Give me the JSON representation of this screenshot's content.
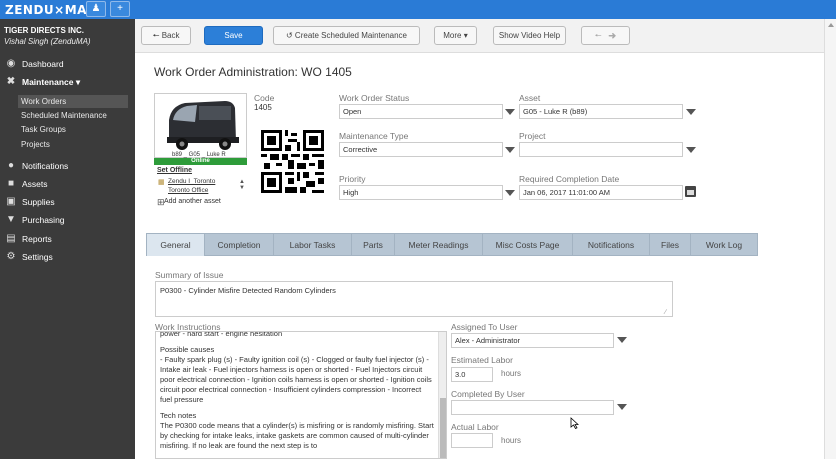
{
  "app": {
    "logo": "ZENDU×MA"
  },
  "topbar": {
    "user_icon": "user-icon",
    "add_icon": "plus-icon"
  },
  "sidebar": {
    "company": "TIGER DIRECTS INC.",
    "user": "Vishal Singh (ZenduMA)",
    "dashboard": "Dashboard",
    "maintenance": "Maintenance ▾",
    "sub": {
      "work_orders": "Work Orders",
      "scheduled": "Scheduled Maintenance",
      "task_groups": "Task Groups",
      "projects": "Projects"
    },
    "notifications": "Notifications",
    "assets": "Assets",
    "supplies": "Supplies",
    "purchasing": "Purchasing",
    "reports": "Reports",
    "settings": "Settings"
  },
  "toolbar": {
    "back": "Back",
    "save": "Save",
    "create_scheduled": "Create Scheduled Maintenance",
    "more": "More ▾",
    "video": "Show Video Help"
  },
  "page": {
    "title": "Work Order Administration: WO 1405"
  },
  "asset_card": {
    "caption": "b89 _ G05 _ Luke R",
    "status": "Online",
    "set_offline": "Set Offline",
    "loc1": "Zendu I_Toronto",
    "loc2": "Toronto Office",
    "add_asset": "Add another asset"
  },
  "form": {
    "code_label": "Code",
    "code_value": "1405",
    "status_label": "Work Order Status",
    "status_value": "Open",
    "asset_label": "Asset",
    "asset_value": "G05 - Luke R (b89)",
    "mtype_label": "Maintenance Type",
    "mtype_value": "Corrective",
    "project_label": "Project",
    "project_value": "",
    "priority_label": "Priority",
    "priority_value": "High",
    "req_label": "Required Completion Date",
    "req_value": "Jan 06, 2017 11:01:00 AM"
  },
  "tabs": [
    "General",
    "Completion",
    "Labor Tasks",
    "Parts",
    "Meter Readings",
    "Misc Costs Page",
    "Notifications",
    "Files",
    "Work Log"
  ],
  "general": {
    "summary_label": "Summary of Issue",
    "summary_value": "P0300 - Cylinder Misfire Detected Random Cylinders",
    "wi_label": "Work Instructions",
    "wi_top": "power - hard start - engine hesitation",
    "wi_causes_title": "Possible causes",
    "wi_causes": "- Faulty spark plug (s) - Faulty ignition coil (s) - Clogged or faulty fuel injector (s) - Intake air leak - Fuel injectors harness is open or shorted - Fuel Injectors circuit poor electrical connection - Ignition coils harness is open or shorted - Ignition coils circuit poor electrical connection - Insufficient cylinders compression - Incorrect fuel pressure",
    "wi_tech_title": "Tech notes",
    "wi_tech": "The P0300 code means that a cylinder(s) is misfiring or is randomly misfiring. Start by checking for intake leaks, intake gaskets are common caused of multi-cylinder misfiring. If no leak are found the next step is to",
    "assigned_label": "Assigned To User",
    "assigned_value": "Alex - Administrator",
    "est_label": "Estimated Labor",
    "est_value": "3.0",
    "hours": "hours",
    "completed_label": "Completed By User",
    "completed_value": "",
    "actual_label": "Actual Labor",
    "actual_value": ""
  }
}
